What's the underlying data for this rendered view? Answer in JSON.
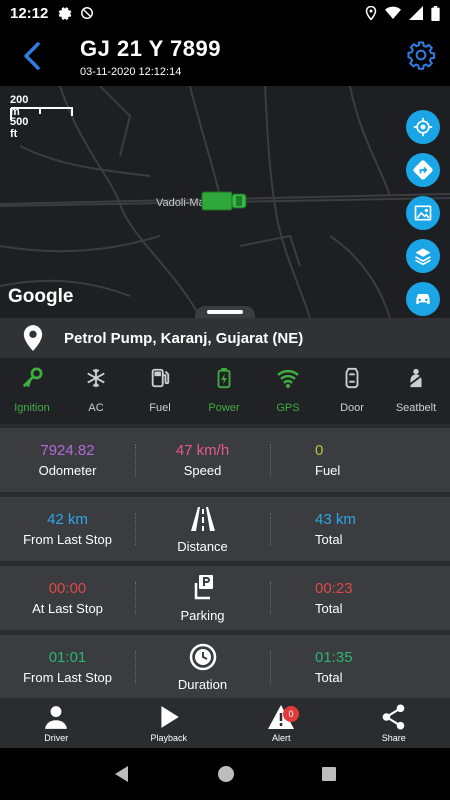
{
  "status_bar": {
    "time": "12:12"
  },
  "header": {
    "vehicle_number": "GJ 21 Y 7899",
    "datetime": "03-11-2020 12:12:14"
  },
  "map": {
    "scale_metric": "200 m",
    "scale_imperial": "500 ft",
    "road_label": "Vadoli-Ma...V",
    "logo": "Google",
    "controls": [
      "my-location-icon",
      "directions-icon",
      "map-type-icon",
      "layers-icon",
      "vehicle-icon"
    ]
  },
  "location": {
    "address": "Petrol Pump, Karanj, Gujarat (NE)"
  },
  "sensors": [
    {
      "label": "Ignition",
      "icon": "key-icon",
      "color": "#3fae3f"
    },
    {
      "label": "AC",
      "icon": "snowflake-icon",
      "color": "#cfcfcf"
    },
    {
      "label": "Fuel",
      "icon": "fuel-icon",
      "color": "#cfcfcf"
    },
    {
      "label": "Power",
      "icon": "battery-icon",
      "color": "#3fae3f"
    },
    {
      "label": "GPS",
      "icon": "wifi-icon",
      "color": "#3fae3f"
    },
    {
      "label": "Door",
      "icon": "door-icon",
      "color": "#cfcfcf"
    },
    {
      "label": "Seatbelt",
      "icon": "seatbelt-icon",
      "color": "#cfcfcf"
    }
  ],
  "stats": {
    "summary": {
      "odometer": {
        "value": "7924.82",
        "label": "Odometer",
        "color": "#b36ad6"
      },
      "speed": {
        "value": "47 km/h",
        "label": "Speed",
        "color": "#e45a8a"
      },
      "fuel": {
        "value": "0",
        "label": "Fuel",
        "color": "#bcc03a"
      }
    },
    "distance": {
      "left_value": "42 km",
      "left_label": "From Last Stop",
      "center_label": "Distance",
      "right_value": "43 km",
      "right_label": "Total",
      "color": "#2fa6e6"
    },
    "parking": {
      "left_value": "00:00",
      "left_label": "At Last Stop",
      "center_label": "Parking",
      "right_value": "00:23",
      "right_label": "Total",
      "color": "#e04848"
    },
    "duration": {
      "left_value": "01:01",
      "left_label": "From Last Stop",
      "center_label": "Duration",
      "right_value": "01:35",
      "right_label": "Total",
      "color": "#2bb673"
    }
  },
  "bottom_nav": {
    "driver": "Driver",
    "playback": "Playback",
    "alert": "Alert",
    "alert_count": "0",
    "share": "Share"
  }
}
